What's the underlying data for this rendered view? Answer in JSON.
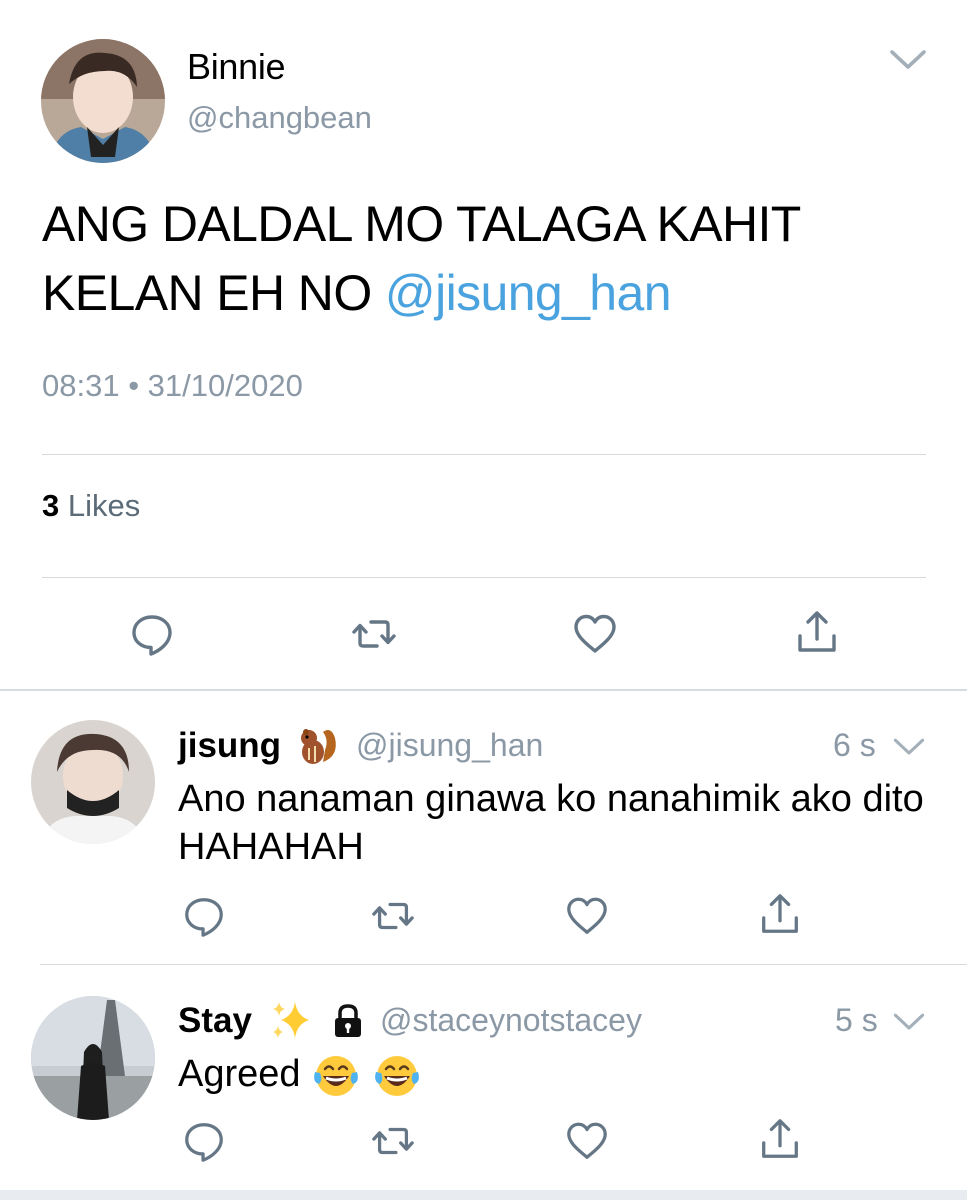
{
  "main_tweet": {
    "author_name": "Binnie",
    "author_handle": "@changbean",
    "text": "ANG DALDAL MO TALAGA KAHIT KELAN EH NO ",
    "mention": "@jisung_han",
    "timestamp": "08:31 • 31/10/2020",
    "likes_count": "3",
    "likes_label": " Likes",
    "actions": [
      "reply-icon",
      "retweet-icon",
      "like-icon",
      "share-icon"
    ]
  },
  "replies": [
    {
      "author_name": "jisung",
      "name_emoji": "chipmunk-emoji",
      "author_handle": "@jisung_han",
      "time": "6 s",
      "text": "Ano nanaman ginawa ko nanahimik ako dito HAHAHAH"
    },
    {
      "author_name": "Stay",
      "name_emoji": "sparkles-emoji",
      "protected_icon": "lock-icon",
      "author_handle": "@staceynotstacey",
      "time": "5 s",
      "text": "Agreed ",
      "text_emojis": [
        "tears-of-joy-emoji",
        "tears-of-joy-emoji"
      ]
    }
  ],
  "colors": {
    "mention": "#4aa3df",
    "secondary_text": "#8b98a5",
    "icon": "#657786",
    "divider": "#d6dbe0"
  }
}
